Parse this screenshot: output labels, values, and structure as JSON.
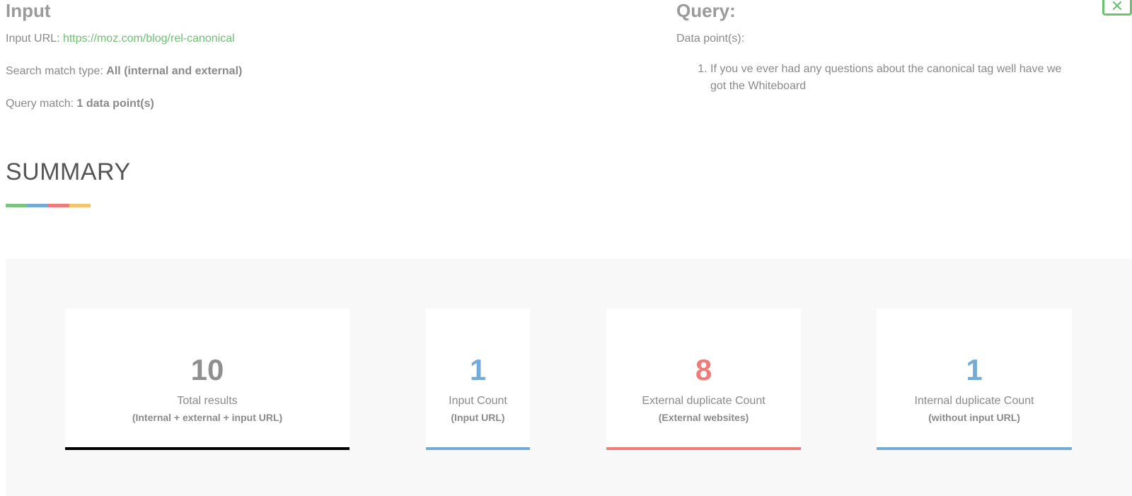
{
  "input": {
    "title": "Input",
    "url_label": "Input URL: ",
    "url_value": "https://moz.com/blog/rel-canonical",
    "match_type_label": "Search match type: ",
    "match_type_value": "All (internal and external)",
    "query_match_label": "Query match: ",
    "query_match_value": "1 data point(s)"
  },
  "query": {
    "title": "Query:",
    "data_points_label": "Data point(s):",
    "items": [
      "If you ve ever had any questions about the canonical tag well have we got the Whiteboard"
    ]
  },
  "summary": {
    "title": "SUMMARY",
    "bar_colors": [
      "#7cc47f",
      "#74aad6",
      "#ef7b7b",
      "#f3c46a"
    ]
  },
  "stats": [
    {
      "value": "10",
      "label": "Total results",
      "sub": "(Internal + external + input URL)",
      "color": "#8f8f8f",
      "line_color": "#000000"
    },
    {
      "value": "1",
      "label": "Input Count",
      "sub": "(Input URL)",
      "color": "#74aad6",
      "line_color": "#74aad6"
    },
    {
      "value": "8",
      "label": "External duplicate Count",
      "sub": "(External websites)",
      "color": "#ef7b7b",
      "line_color": "#ef7b7b"
    },
    {
      "value": "1",
      "label": "Internal duplicate Count",
      "sub": "(without input URL)",
      "color": "#74aad6",
      "line_color": "#74aad6"
    }
  ],
  "icons": {
    "corner": "export-icon"
  }
}
